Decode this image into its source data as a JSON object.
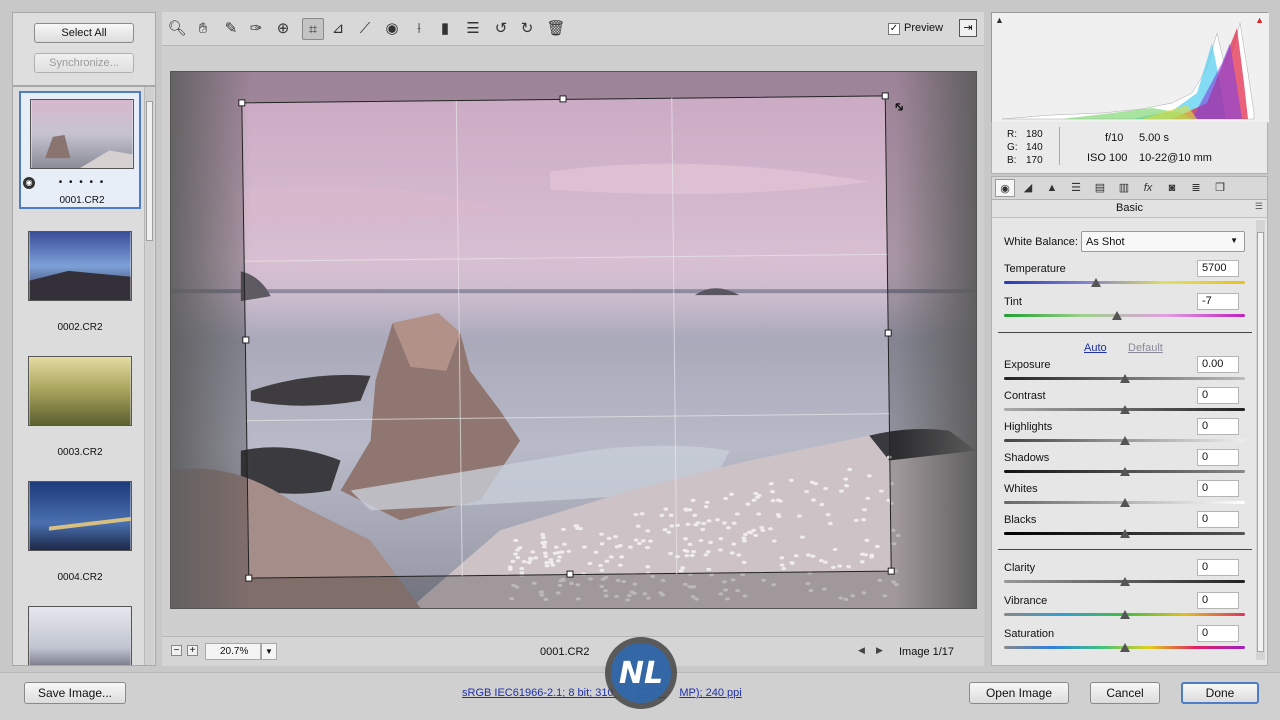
{
  "filmstrip": {
    "select_all": "Select All",
    "synchronize": "Synchronize...",
    "items": [
      {
        "label": "0001.CR2",
        "rating": "• • • • •"
      },
      {
        "label": "0002.CR2"
      },
      {
        "label": "0003.CR2"
      },
      {
        "label": "0004.CR2"
      },
      {
        "label": ""
      }
    ]
  },
  "toolbar": {
    "tools": [
      "zoom-icon",
      "hand-icon",
      "white-balance-icon",
      "color-sampler-icon",
      "target-adjust-icon",
      "crop-icon",
      "straighten-icon",
      "spot-removal-icon",
      "red-eye-icon",
      "adjustment-brush-icon",
      "graduated-filter-icon",
      "preferences-icon",
      "rotate-ccw-icon",
      "rotate-cw-icon",
      "trash-icon"
    ],
    "preview_label": "Preview",
    "preview_checked": true
  },
  "canvas": {
    "zoom": "20.7%",
    "filename": "0001.CR2",
    "image_counter": "Image 1/17"
  },
  "readout": {
    "r_label": "R:",
    "r_value": "180",
    "g_label": "G:",
    "g_value": "140",
    "b_label": "B:",
    "b_value": "170",
    "aperture": "f/10",
    "shutter": "5.00 s",
    "iso": "ISO 100",
    "lens": "10-22@10 mm"
  },
  "panel": {
    "title": "Basic",
    "white_balance_label": "White Balance:",
    "white_balance_value": "As Shot",
    "auto_label": "Auto",
    "default_label": "Default",
    "sliders": {
      "temperature": {
        "label": "Temperature",
        "value": "5700",
        "level": 0.38
      },
      "tint": {
        "label": "Tint",
        "value": "-7",
        "level": 0.47
      },
      "exposure": {
        "label": "Exposure",
        "value": "0.00",
        "level": 0.5
      },
      "contrast": {
        "label": "Contrast",
        "value": "0",
        "level": 0.5
      },
      "highlights": {
        "label": "Highlights",
        "value": "0",
        "level": 0.5
      },
      "shadows": {
        "label": "Shadows",
        "value": "0",
        "level": 0.5
      },
      "whites": {
        "label": "Whites",
        "value": "0",
        "level": 0.5
      },
      "blacks": {
        "label": "Blacks",
        "value": "0",
        "level": 0.5
      },
      "clarity": {
        "label": "Clarity",
        "value": "0",
        "level": 0.5
      },
      "vibrance": {
        "label": "Vibrance",
        "value": "0",
        "level": 0.5
      },
      "saturation": {
        "label": "Saturation",
        "value": "0",
        "level": 0.5
      }
    }
  },
  "bottom": {
    "save_image": "Save Image...",
    "workflow_link": "sRGB IEC61966-2.1; 8 bit; 310",
    "workflow_link_end": "2297",
    "workflow_link_tail": "MP); 240 ppi",
    "open_image": "Open Image",
    "cancel": "Cancel",
    "done": "Done"
  },
  "colors": {
    "selection_blue": "#4d7cc8",
    "link_blue": "#2030a8"
  }
}
